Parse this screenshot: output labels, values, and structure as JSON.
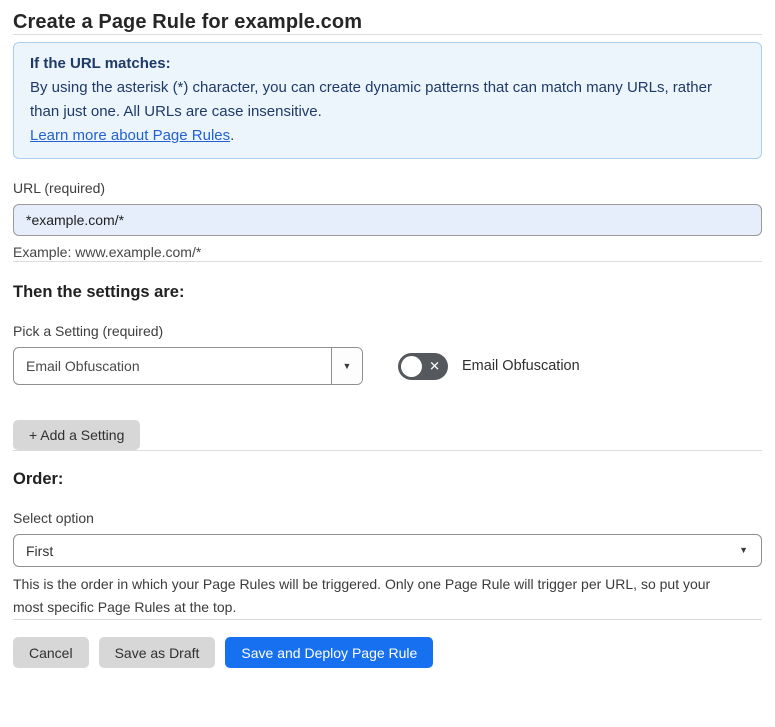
{
  "page": {
    "title": "Create a Page Rule for example.com"
  },
  "info_box": {
    "heading": "If the URL matches:",
    "body": "By using the asterisk (*) character, you can create dynamic patterns that can match many URLs, rather than just one. All URLs are case insensitive.",
    "link_label": "Learn more about Page Rules",
    "link_suffix": "."
  },
  "url_section": {
    "label": "URL (required)",
    "input_value": "*example.com/*",
    "example": "Example: www.example.com/*"
  },
  "settings_section": {
    "heading": "Then the settings are:",
    "pick_label": "Pick a Setting (required)",
    "selected_setting": "Email Obfuscation",
    "toggle_label": "Email Obfuscation",
    "toggle_state": "off",
    "add_button_label": "+ Add a Setting"
  },
  "order_section": {
    "heading": "Order:",
    "label": "Select option",
    "selected_option": "First",
    "help_text": "This is the order in which your Page Rules will be triggered. Only one Page Rule will trigger per URL, so put your most specific Page Rules at the top."
  },
  "footer": {
    "cancel_label": "Cancel",
    "save_draft_label": "Save as Draft",
    "save_deploy_label": "Save and Deploy Page Rule"
  },
  "icons": {
    "caret_glyph": "▼",
    "x_glyph": "✕"
  },
  "colors": {
    "accent_blue": "#1670f0",
    "info_bg": "#edf5fc",
    "info_border": "#abcdee",
    "info_text": "#1e3a68",
    "link_blue": "#2361d2",
    "input_bg": "#e6edfb",
    "toggle_off_bg": "#55585c"
  }
}
